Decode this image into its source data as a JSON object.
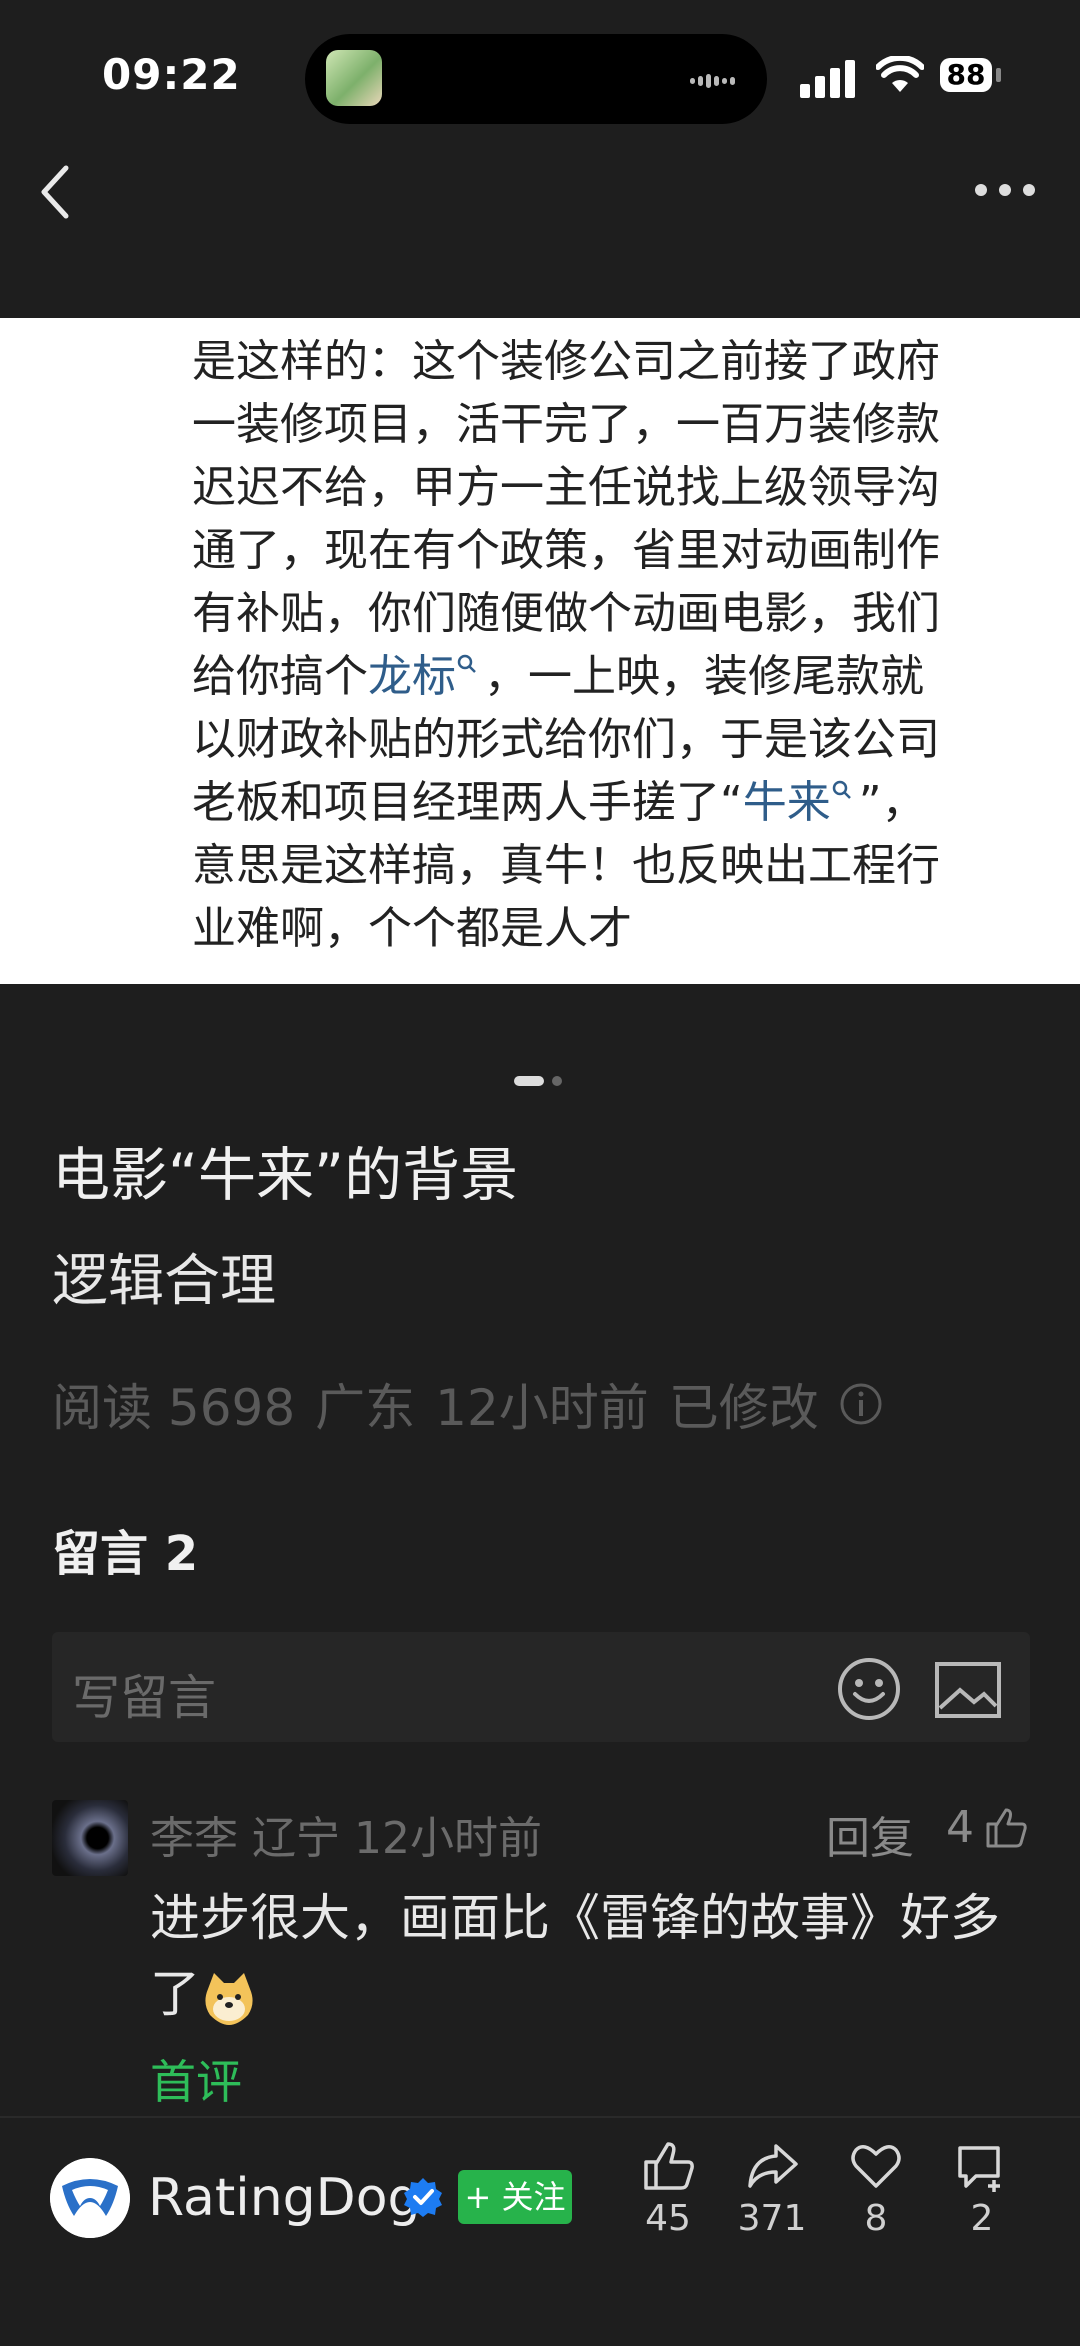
{
  "status_bar": {
    "time": "09:22",
    "battery": "88"
  },
  "article_image": {
    "lines": [
      "是这样的：这个装修公司之前接了政府",
      "一装修项目，活干完了，一百万装修款",
      "迟迟不给，甲方一主任说找上级领导沟",
      "通了，现在有个政策，省里对动画制作",
      "有补贴，你们随便做个动画电影，我们"
    ],
    "line6_before": "给你搞个",
    "line6_link": "龙标",
    "line6_after": "，一上映，装修尾款就",
    "line7": "以财政补贴的形式给你们，于是该公司",
    "line8_before": "老板和项目经理两人手搓了“",
    "line8_link": "牛来",
    "line8_after": "”，",
    "line9": "意思是这样搞，真牛！也反映出工程行",
    "line10": "业难啊，个个都是人才"
  },
  "post": {
    "title": "电影“牛来”的背景",
    "subtitle": "逻辑合理",
    "meta": {
      "reads": "阅读 5698",
      "location": "广东",
      "time": "12小时前",
      "edited": "已修改"
    }
  },
  "comments": {
    "header": "留言 2",
    "input_placeholder": "写留言",
    "items": [
      {
        "author": "李李",
        "location": "辽宁",
        "time": "12小时前",
        "reply_label": "回复",
        "likes": "4",
        "text_line1": "进步很大，画面比《雷锋的故事》好多",
        "text_line2": "了",
        "badge": "首评"
      }
    ]
  },
  "footer": {
    "brand": "RatingDog",
    "follow_label": "+ 关注",
    "actions": [
      {
        "icon": "thumbs-up-icon",
        "count": "45"
      },
      {
        "icon": "share-icon",
        "count": "371"
      },
      {
        "icon": "heart-icon",
        "count": "8"
      },
      {
        "icon": "comment-icon",
        "count": "2"
      }
    ]
  },
  "colors": {
    "background": "#1e1e1e",
    "accent_green": "#27b34b",
    "link_blue": "#2f5d8a",
    "verified_blue": "#1d7cf2"
  }
}
